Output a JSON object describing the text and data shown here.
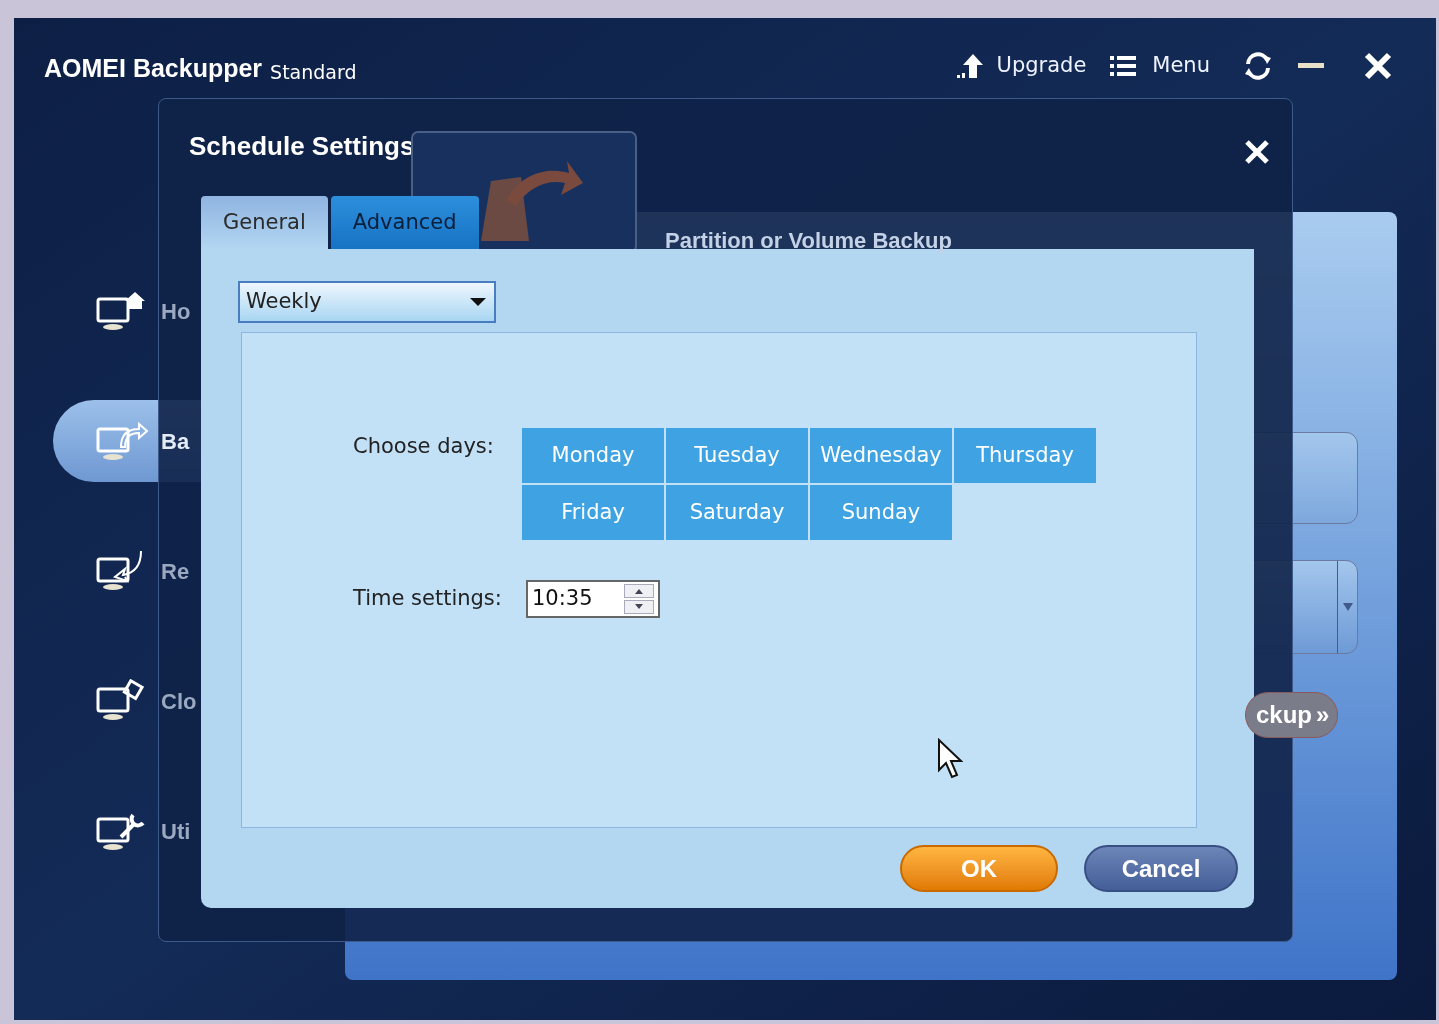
{
  "app": {
    "title": "AOMEI Backupper",
    "edition": "Standard",
    "upgrade": "Upgrade",
    "menu": "Menu"
  },
  "sidebar": {
    "items": [
      {
        "label": "Ho",
        "kind": "home",
        "selected": false
      },
      {
        "label": "Ba",
        "kind": "backup",
        "selected": true
      },
      {
        "label": "Re",
        "kind": "restore",
        "selected": false
      },
      {
        "label": "Clo",
        "kind": "clone",
        "selected": false
      },
      {
        "label": "Uti",
        "kind": "tools",
        "selected": false
      }
    ]
  },
  "main": {
    "heading": "Partition or Volume Backup",
    "start_button": "ckup",
    "start_button_arrows": "»"
  },
  "dialog": {
    "title": "Schedule Settings",
    "tabs": [
      {
        "label": "General",
        "selected": true
      },
      {
        "label": "Advanced",
        "selected": false
      }
    ],
    "frequency": "Weekly",
    "days_label": "Choose days:",
    "days": [
      "Monday",
      "Tuesday",
      "Wednesday",
      "Thursday",
      "Friday",
      "Saturday",
      "Sunday"
    ],
    "time_label": "Time settings:",
    "time": "10:35",
    "buttons": [
      {
        "label": "OK",
        "kind": "primary"
      },
      {
        "label": "Cancel",
        "kind": "secondary"
      }
    ]
  }
}
